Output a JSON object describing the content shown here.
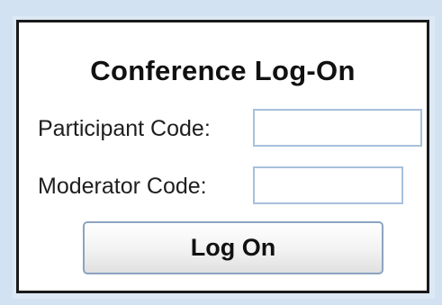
{
  "dialog": {
    "title": "Conference Log-On",
    "participant_label": "Participant Code:",
    "participant_value": "",
    "moderator_label": "Moderator Code:",
    "moderator_value": "",
    "logon_button_label": "Log On"
  }
}
